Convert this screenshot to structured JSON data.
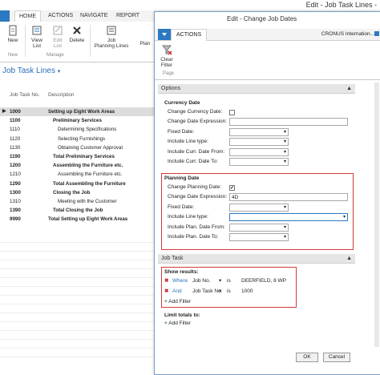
{
  "window": {
    "title": "Edit - Job Task Lines -"
  },
  "ribbon": {
    "file_label": "",
    "tabs": [
      "HOME",
      "ACTIONS",
      "NAVIGATE",
      "REPORT"
    ],
    "buttons": {
      "new": "New",
      "view_list": "View\nList",
      "edit_list": "Edit\nList",
      "delete": "Delete",
      "job_planning_lines": "Job\nPlanning Lines",
      "plan": "Plan"
    },
    "groups": {
      "new": "New",
      "manage": "Manage"
    }
  },
  "page": {
    "title": "Job Task Lines"
  },
  "grid": {
    "headers": [
      "Job Task No.",
      "Description"
    ],
    "rows": [
      {
        "no": "1000",
        "desc": "Setting up Eight Work Areas",
        "bold": true,
        "indent": 0,
        "selected": true,
        "arrow": true
      },
      {
        "no": "1100",
        "desc": "Preliminary Services",
        "bold": true,
        "indent": 1
      },
      {
        "no": "1110",
        "desc": "Determining Specifications",
        "bold": false,
        "indent": 2
      },
      {
        "no": "1120",
        "desc": "Selecting Furnishings",
        "bold": false,
        "indent": 2
      },
      {
        "no": "1130",
        "desc": "Obtaining Customer Approval",
        "bold": false,
        "indent": 2
      },
      {
        "no": "1190",
        "desc": "Total Preliminary Services",
        "bold": true,
        "indent": 1
      },
      {
        "no": "1200",
        "desc": "Assembling the Furniture etc.",
        "bold": true,
        "indent": 1
      },
      {
        "no": "1210",
        "desc": "Assembling the Furniture etc.",
        "bold": false,
        "indent": 2
      },
      {
        "no": "1290",
        "desc": "Total Assembling the Furniture",
        "bold": true,
        "indent": 1
      },
      {
        "no": "1300",
        "desc": "Closing the Job",
        "bold": true,
        "indent": 1
      },
      {
        "no": "1310",
        "desc": "Meeting with the Customer",
        "bold": false,
        "indent": 2
      },
      {
        "no": "1390",
        "desc": "Total Closing the Job",
        "bold": true,
        "indent": 1
      },
      {
        "no": "9990",
        "desc": "Total Setting up Eight Work Areas",
        "bold": true,
        "indent": 0
      }
    ]
  },
  "dialog": {
    "title": "Edit - Change Job Dates",
    "tab": "ACTIONS",
    "company": "CRONUS Internation...",
    "clear_filter": "Clear\nFilter",
    "page_group": "Page",
    "options_label": "Options",
    "currency_date": {
      "header": "Currency Date",
      "fields": [
        {
          "label": "Change Currency Date:",
          "type": "checkbox",
          "checked": false
        },
        {
          "label": "Change Date Expression:",
          "type": "text",
          "value": ""
        },
        {
          "label": "Fixed Date:",
          "type": "select",
          "value": ""
        },
        {
          "label": "Include Line type:",
          "type": "select",
          "value": ""
        },
        {
          "label": "Include Curr. Date From:",
          "type": "select",
          "value": ""
        },
        {
          "label": "Include Curr. Date To:",
          "type": "select",
          "value": ""
        }
      ]
    },
    "planning_date": {
      "header": "Planning Date",
      "fields": [
        {
          "label": "Change Planning Date:",
          "type": "checkbox",
          "checked": true
        },
        {
          "label": "Change Date Expression:",
          "type": "text",
          "value": "4D"
        },
        {
          "label": "Fixed Date:",
          "type": "select",
          "value": ""
        },
        {
          "label": "Include Line type:",
          "type": "select-wide",
          "value": ""
        },
        {
          "label": "Include Plan. Date From:",
          "type": "select",
          "value": ""
        },
        {
          "label": "Include Plan. Date To:",
          "type": "select",
          "value": ""
        }
      ]
    },
    "job_task_label": "Job Task",
    "show_results": "Show results:",
    "filters": [
      {
        "conj": "Where",
        "field": "Job No.",
        "op": "is",
        "value": "DEERFIELD, 8 WP"
      },
      {
        "conj": "And",
        "field": "Job Task No.",
        "op": "is",
        "value": "1000"
      }
    ],
    "add_filter": "Add Filter",
    "limit_totals": "Limit totals to:",
    "add_filter2": "Add Filter",
    "ok": "OK",
    "cancel": "Cancel"
  },
  "colors": {
    "accent": "#2b79c2",
    "highlight": "#d23a3a"
  }
}
